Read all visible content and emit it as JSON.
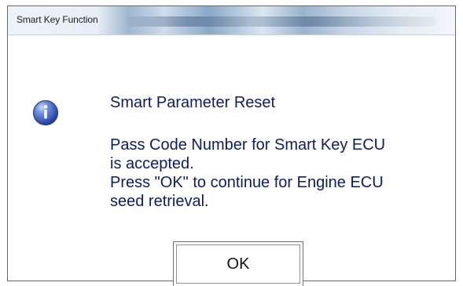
{
  "window": {
    "title": "Smart Key Function",
    "icon": "info-icon",
    "title_gradient_colors": [
      "#eef3f8",
      "#9fb7cf",
      "#8aa8c7",
      "#dbe6f1",
      "#f3f6f9"
    ]
  },
  "dialog": {
    "heading": "Smart Parameter Reset",
    "lines": [
      "Pass Code Number for Smart Key ECU",
      "is accepted.",
      "Press \"OK\" to continue for Engine ECU",
      "seed retrieval."
    ]
  },
  "buttons": {
    "ok_label": "OK"
  },
  "colors": {
    "message_text": "#0b1d66",
    "dialog_border": "#5f6a75",
    "button_border": "#6f6f6f"
  }
}
